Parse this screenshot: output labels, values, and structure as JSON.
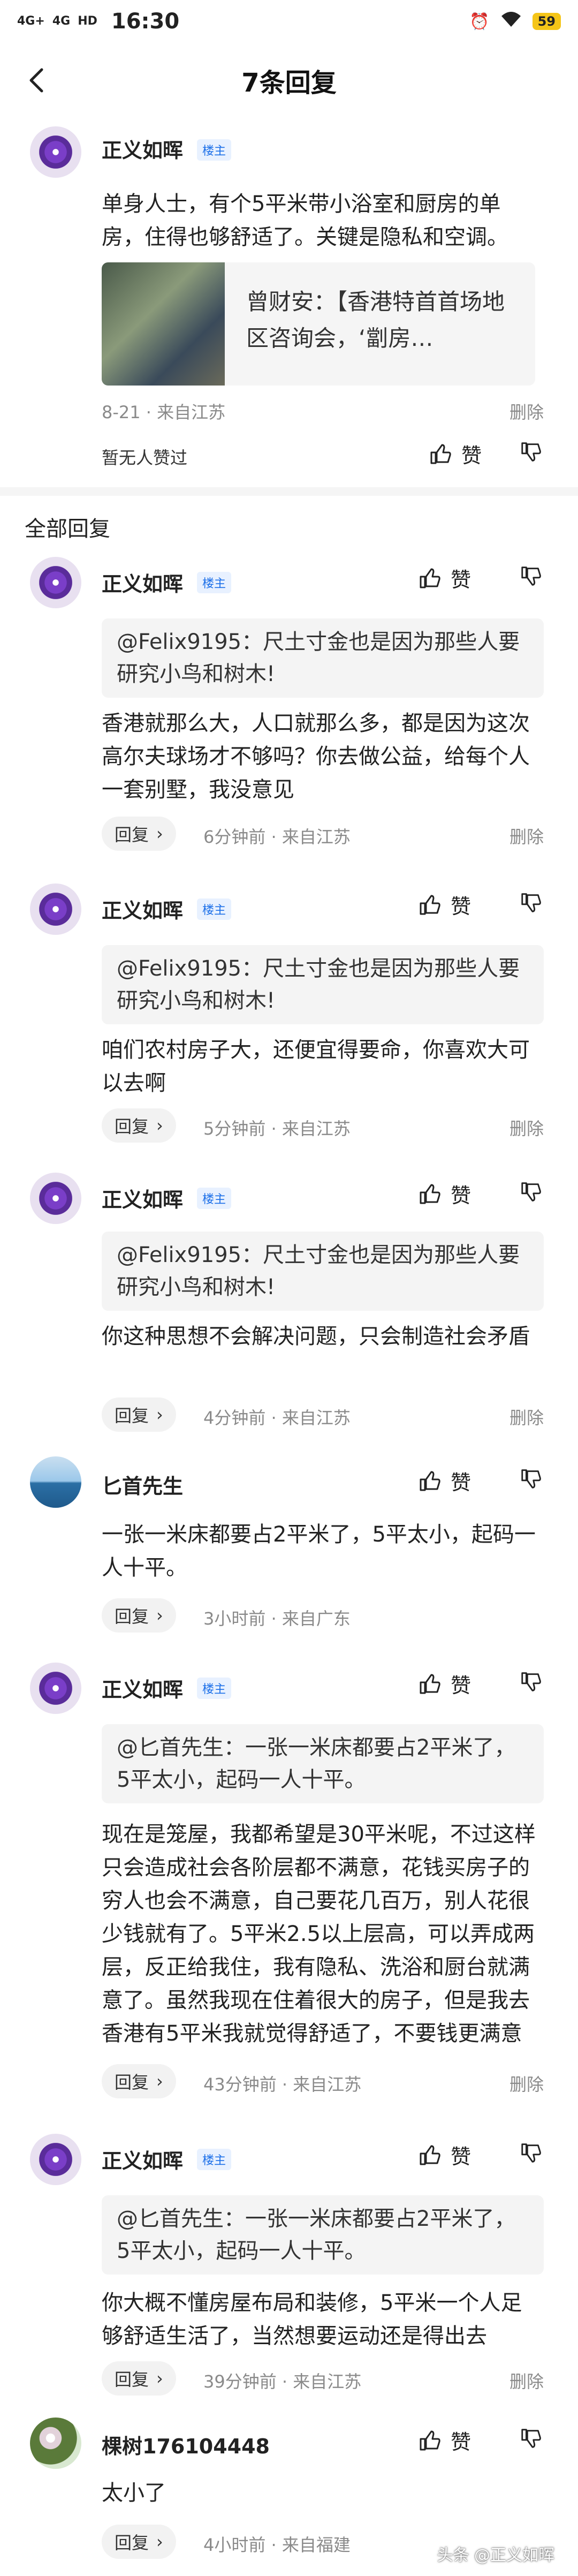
{
  "status": {
    "signal1": "4G+",
    "signal2": "4G",
    "hd": "HD",
    "time": "16:30",
    "battery": "59"
  },
  "nav": {
    "title": "7条回复"
  },
  "post": {
    "author": "正义如晖",
    "badge": "楼主",
    "text": "单身人士，有个5平米带小浴室和厨房的单房，住得也够舒适了。关键是隐私和空调。",
    "link_text": "曾财安：【香港特首首场地区咨询会，‘劏房…",
    "meta": "8-21 · 来自江苏",
    "delete": "删除",
    "no_likes": "暂无人赞过",
    "like_label": "赞"
  },
  "section": {
    "title": "全部回复"
  },
  "replies": [
    {
      "author": "正义如晖",
      "badge": "楼主",
      "quote": "@Felix9195：尺土寸金也是因为那些人要研究小鸟和树木!",
      "text": "香港就那么大，人口就那么多，都是因为这次高尔夫球场才不够吗？你去做公益，给每个人一套别墅，我没意见",
      "reply": "回复",
      "meta": "6分钟前 · 来自江苏",
      "delete": "删除",
      "like": "赞"
    },
    {
      "author": "正义如晖",
      "badge": "楼主",
      "quote": "@Felix9195：尺土寸金也是因为那些人要研究小鸟和树木!",
      "text": "咱们农村房子大，还便宜得要命，你喜欢大可以去啊",
      "reply": "回复",
      "meta": "5分钟前 · 来自江苏",
      "delete": "删除",
      "like": "赞"
    },
    {
      "author": "正义如晖",
      "badge": "楼主",
      "quote": "@Felix9195：尺土寸金也是因为那些人要研究小鸟和树木!",
      "text": "你这种思想不会解决问题，只会制造社会矛盾",
      "reply": "回复",
      "meta": "4分钟前 · 来自江苏",
      "delete": "删除",
      "like": "赞"
    },
    {
      "author": "匕首先生",
      "text": "一张一米床都要占2平米了，5平太小，起码一人十平。",
      "reply": "回复",
      "meta": "3小时前 · 来自广东",
      "like": "赞"
    },
    {
      "author": "正义如晖",
      "badge": "楼主",
      "quote": "@匕首先生：一张一米床都要占2平米了，5平太小，起码一人十平。",
      "text": "现在是笼屋，我都希望是30平米呢，不过这样只会造成社会各阶层都不满意，花钱买房子的穷人也会不满意，自己要花几百万，别人花很少钱就有了。5平米2.5以上层高，可以弄成两层，反正给我住，我有隐私、洗浴和厨台就满意了。虽然我现在住着很大的房子，但是我去香港有5平米我就觉得舒适了，不要钱更满意",
      "reply": "回复",
      "meta": "43分钟前 · 来自江苏",
      "delete": "删除",
      "like": "赞"
    },
    {
      "author": "正义如晖",
      "badge": "楼主",
      "quote": "@匕首先生：一张一米床都要占2平米了，5平太小，起码一人十平。",
      "text": "你大概不懂房屋布局和装修，5平米一个人足够舒适生活了，当然想要运动还是得出去",
      "reply": "回复",
      "meta": "39分钟前 · 来自江苏",
      "delete": "删除",
      "like": "赞"
    },
    {
      "author": "棵树176104448",
      "text": "太小了",
      "reply": "回复",
      "meta": "4小时前 · 来自福建",
      "like": "赞"
    }
  ],
  "watermark": "头条 @正义如晖"
}
